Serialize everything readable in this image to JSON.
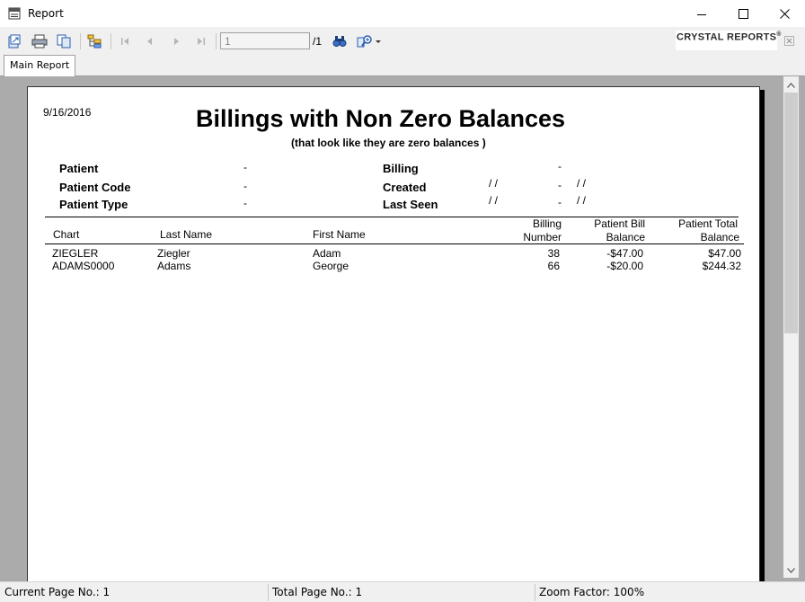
{
  "window": {
    "title": "Report"
  },
  "toolbar": {
    "page_current": "1",
    "page_total": "/1",
    "brand": "CRYSTAL REPORTS",
    "brand_mark": "®",
    "icons": [
      "export-icon",
      "print-icon",
      "copy-icon",
      "group-tree-icon",
      "first-page-icon",
      "prev-page-icon",
      "next-page-icon",
      "last-page-icon",
      "find-icon",
      "zoom-icon"
    ]
  },
  "tabs": [
    {
      "label": "Main Report"
    }
  ],
  "report": {
    "date": "9/16/2016",
    "title": "Billings with Non Zero Balances",
    "subtitle": "(that look like they are zero balances )",
    "params": {
      "patient_label": "Patient",
      "patient_value": "-",
      "patient_code_label": "Patient Code",
      "patient_code_value": "-",
      "patient_type_label": "Patient Type",
      "patient_type_value": "-",
      "billing_label": "Billing",
      "billing_value": "-",
      "created_label": "Created",
      "created_from": "/ /",
      "created_dash": "-",
      "created_to": "/ /",
      "last_seen_label": "Last Seen",
      "last_seen_from": "/ /",
      "last_seen_dash": "-",
      "last_seen_to": "/ /"
    },
    "columns": {
      "chart": "Chart",
      "last_name": "Last Name",
      "first_name": "First Name",
      "billing_1": "Billing",
      "billing_2": "Number",
      "pbill_1": "Patient Bill",
      "pbill_2": "Balance",
      "ptotal_1": "Patient Total",
      "ptotal_2": "Balance"
    },
    "rows": [
      {
        "chart": "ZIEGLER",
        "last": "Ziegler",
        "first": "Adam",
        "billing": "38",
        "bill_bal": "-$47.00",
        "total_bal": "$47.00"
      },
      {
        "chart": "ADAMS0000",
        "last": "Adams",
        "first": "George",
        "billing": "66",
        "bill_bal": "-$20.00",
        "total_bal": "$244.32"
      }
    ]
  },
  "status": {
    "current_page": "Current Page No.: 1",
    "total_page": "Total Page No.: 1",
    "zoom": "Zoom Factor: 100%"
  }
}
